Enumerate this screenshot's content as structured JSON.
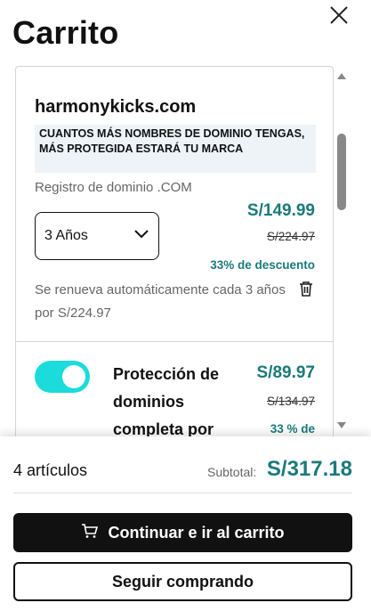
{
  "header": {
    "title": "Carrito",
    "close_icon": "close-icon"
  },
  "item": {
    "domain": "harmonykicks.com",
    "promo": "CUANTOS MÁS NOMBRES DE DOMINIO TENGAS, MÁS PROTEGIDA ESTARÁ TU MARCA",
    "description": "Registro de dominio .COM",
    "term_selected": "3 Años",
    "price": "S/149.99",
    "old_price": "S/224.97",
    "discount": "33% de descuento",
    "renewal": "Se renueva automáticamente cada 3 años por S/224.97",
    "delete_icon": "trash-icon"
  },
  "protection": {
    "enabled": true,
    "title": "Protección de dominios completa por",
    "price": "S/89.97",
    "old_price": "S/134.97",
    "discount": "33 % de"
  },
  "footer": {
    "count": "4 artículos",
    "subtotal_label": "Subtotal:",
    "subtotal_value": "S/317.18",
    "checkout_label": "Continuar e ir al carrito",
    "continue_label": "Seguir comprando",
    "cart_icon": "cart-icon"
  },
  "colors": {
    "accent": "#1b7a7b",
    "toggle": "#1bdbdb",
    "primary_button": "#111111"
  }
}
